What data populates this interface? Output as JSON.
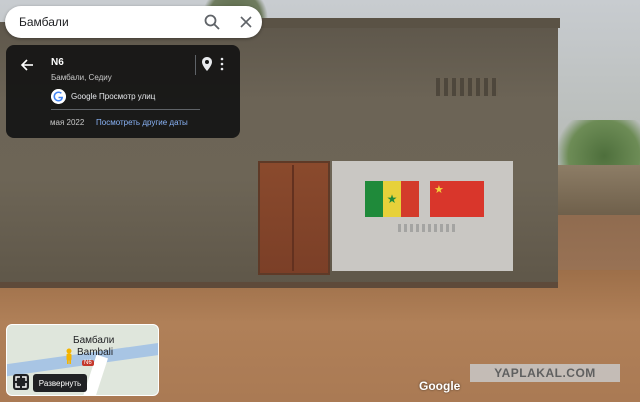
{
  "search": {
    "value": "Бамбали",
    "search_icon": "search-icon",
    "close_icon": "close-icon"
  },
  "info_card": {
    "title": "N6",
    "subtitle": "Бамбали, Седиу",
    "service_label": "Google Просмотр улиц",
    "capture_date": "мая 2022",
    "other_dates_link": "Посмотреть другие даты",
    "icons": [
      "back-arrow-icon",
      "location-pin-icon",
      "more-vert-icon",
      "google-g-icon"
    ]
  },
  "minimap": {
    "label_local": "Бамбали",
    "label_latin": "Bambali",
    "road_shield": "N6",
    "expand_label": "Развернуть",
    "icons": [
      "pegman-icon",
      "expand-icon"
    ]
  },
  "watermarks": {
    "google": "Google",
    "yaplakal": "YAPLAKAL.COM"
  },
  "colors": {
    "link": "#8ab4f8",
    "card_bg": "#141414",
    "flag_green": "#1f8a3a",
    "flag_yellow": "#e7d13a",
    "flag_red": "#d33b2b",
    "cn_red": "#d9362b"
  }
}
